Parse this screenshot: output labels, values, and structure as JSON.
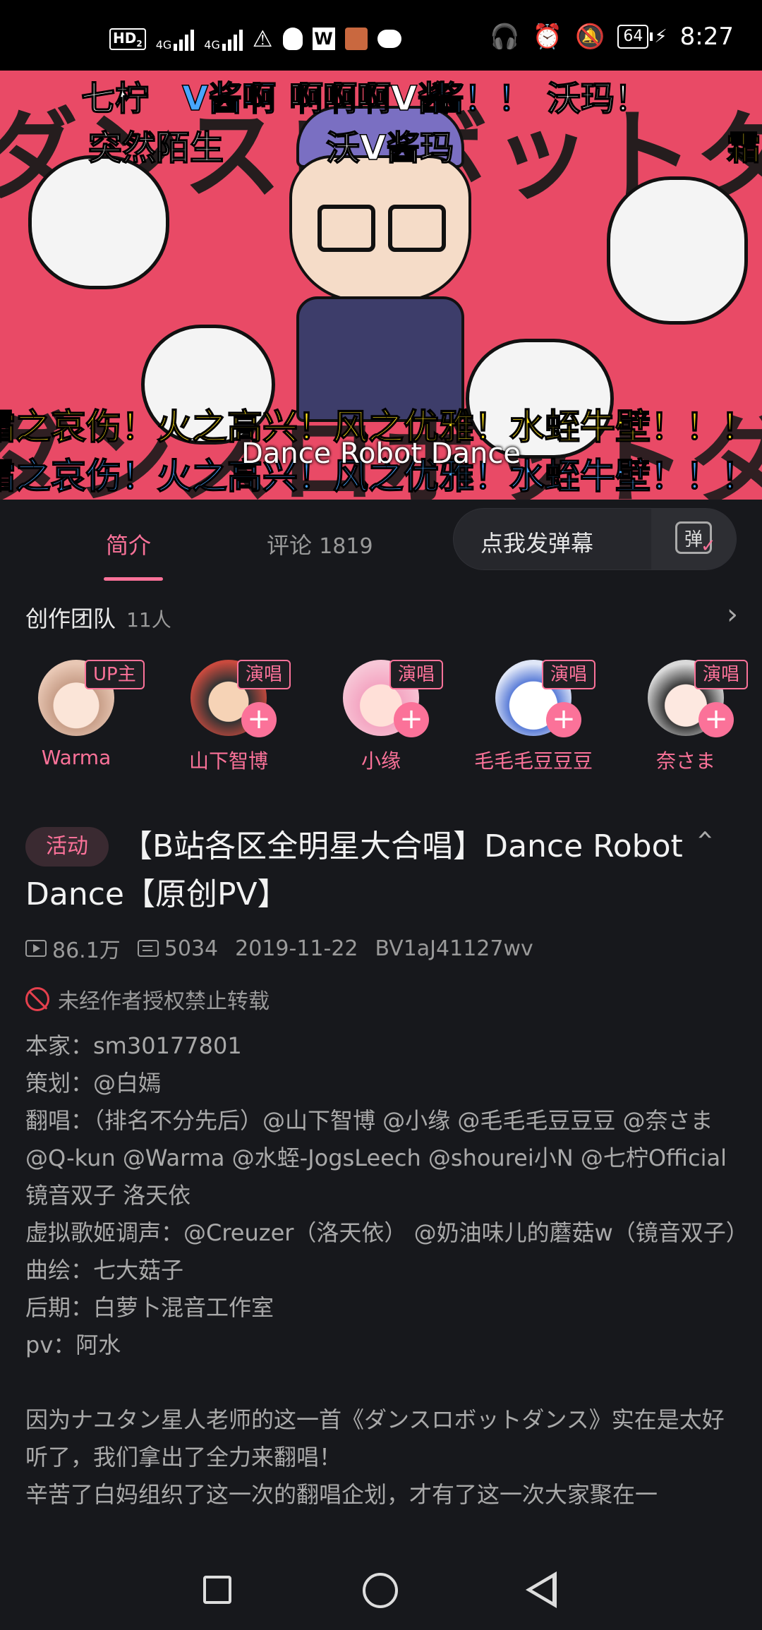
{
  "status_bar": {
    "left_icons": [
      "hd-icon",
      "signal-4g-icon",
      "signal-4g-icon",
      "warning-icon",
      "qq-icon",
      "wps-icon",
      "app-avatar-icon",
      "chat-icon"
    ],
    "hd_label": "HD",
    "hd_sub": "2",
    "net1": "4G",
    "net2": "4G",
    "battery": "64",
    "time": "8:27"
  },
  "video": {
    "bg_text_top": "ダンスロボットダンス",
    "bg_text_bottom": "ダンスロボットダンス",
    "danmaku": [
      {
        "text": "七柠",
        "color": "white"
      },
      {
        "text": "V酱啊",
        "color": "blue"
      },
      {
        "text": "啊啊啊V酱",
        "color": "white"
      },
      {
        "text": "酱！！",
        "color": "blue"
      },
      {
        "text": "沃玛！",
        "color": "white"
      },
      {
        "text": "突然陌生",
        "color": "white"
      },
      {
        "text": "沃V酱玛",
        "color": "white"
      },
      {
        "text": "霜",
        "color": "yellow"
      },
      {
        "text": "霜之哀伤！火之高兴！风之优雅！水蛭牛壁！！！",
        "color": "yellow"
      },
      {
        "text": "霜之哀伤！火之高兴！风之优雅！水蛭牛壁！！！",
        "color": "blue"
      }
    ],
    "subtitle": "Dance Robot Dance"
  },
  "tabs": {
    "intro": "简介",
    "comments": "评论",
    "comment_count": "1819",
    "danmaku_input": "点我发弹幕",
    "danmaku_toggle": "弹"
  },
  "team": {
    "title": "创作团队",
    "count": "11人",
    "members": [
      {
        "name": "Warma",
        "role": "UP主"
      },
      {
        "name": "山下智博",
        "role": "演唱"
      },
      {
        "name": "小缘",
        "role": "演唱"
      },
      {
        "name": "毛毛毛豆豆豆",
        "role": "演唱"
      },
      {
        "name": "奈さま",
        "role": "演唱"
      }
    ]
  },
  "info": {
    "tag": "活动",
    "title": "【B站各区全明星大合唱】Dance Robot Dance【原创PV】",
    "views": "86.1万",
    "danmaku_count": "5034",
    "date": "2019-11-22",
    "bvid": "BV1aJ41127wv",
    "copyright": "未经作者授权禁止转载",
    "desc_lines": [
      "本家：sm30177801",
      "策划：@白嫣",
      "翻唱：（排名不分先后）@山下智博 @小缘 @毛毛毛豆豆豆 @奈さま @Q-kun @Warma @水蛭-JogsLeech @shourei小N @七柠Official 镜音双子 洛天依",
      "虚拟歌姬调声：@Creuzer（洛天依） @奶油味儿的蘑菇w（镜音双子）",
      "曲绘：七大菇子",
      "后期：白萝卜混音工作室",
      "pv：阿水"
    ],
    "desc_para": [
      "因为ナユタン星人老师的这一首《ダンスロボットダンス》实在是太好听了，我们拿出了全力来翻唱！",
      "辛苦了白妈组织了这一次的翻唱企划，才有了这一次大家聚在一"
    ]
  },
  "colors": {
    "accent": "#fb7299",
    "background": "#17181c",
    "video_bg": "#e94a66"
  }
}
